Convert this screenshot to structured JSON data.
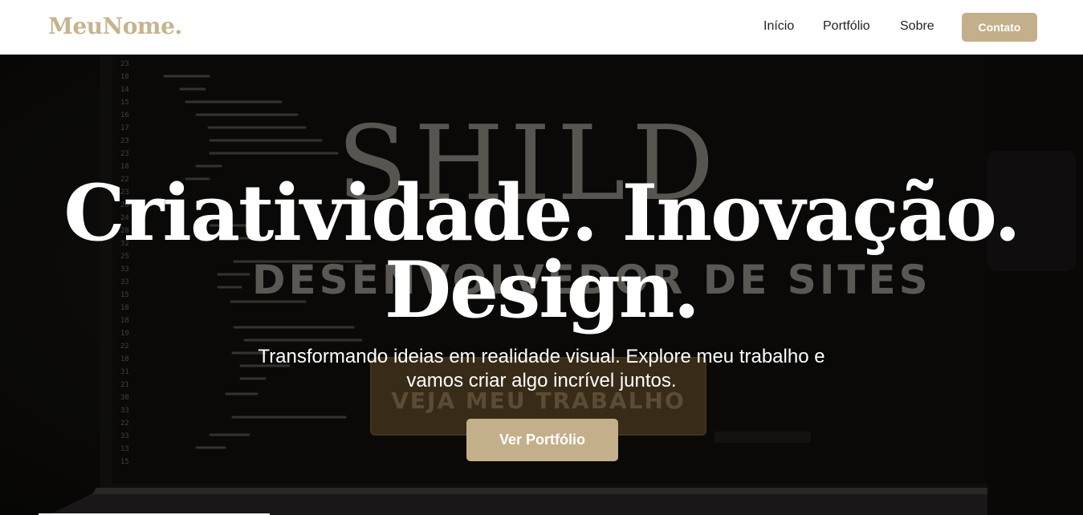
{
  "brand": {
    "logo": "MeuNome.",
    "accent_color": "#c3b08a"
  },
  "nav": {
    "links": [
      "Início",
      "Portfólio",
      "Sobre"
    ],
    "cta": "Contato"
  },
  "hero": {
    "background_image": {
      "word_1": "SHILD",
      "word_2": "DESENVOLVEDOR DE SITES",
      "button_text": "VEJA MEU TRABALHO"
    },
    "title_line_1": "Criatividade. Inovação.",
    "title_line_2": "Design.",
    "subtitle": "Transformando ideias em realidade visual. Explore meu trabalho e vamos criar algo incrível juntos.",
    "cta": "Ver Portfólio"
  }
}
